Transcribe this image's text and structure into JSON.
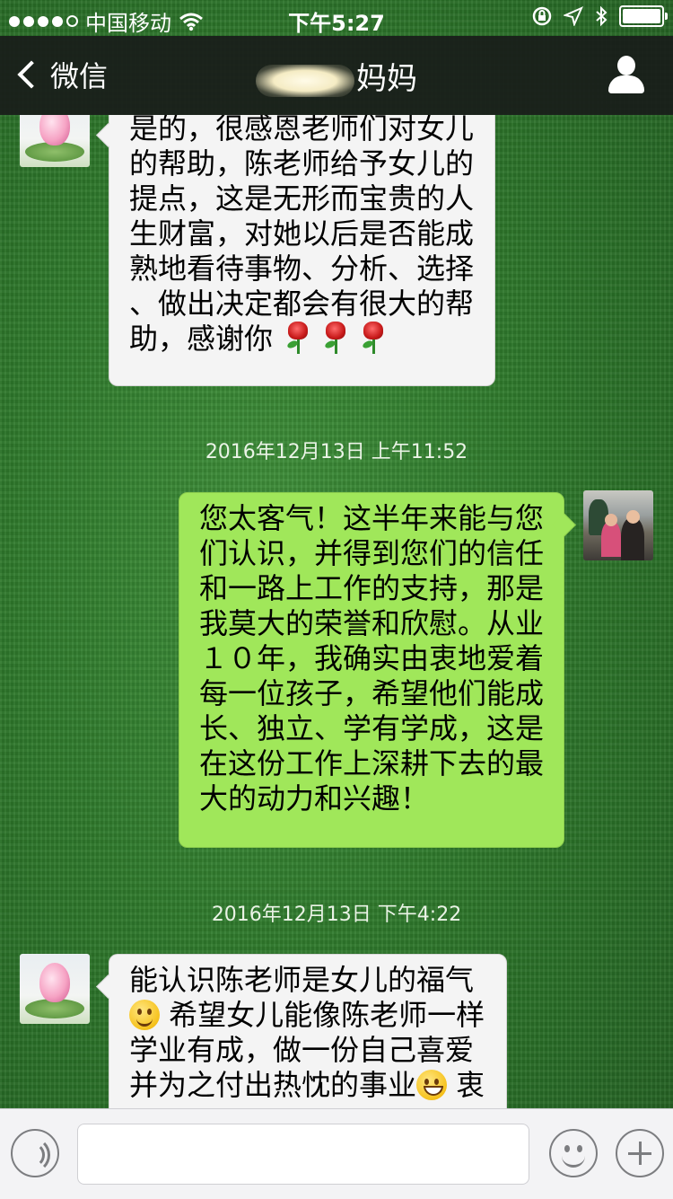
{
  "status_bar": {
    "carrier": "中国移动",
    "time": "下午5:27",
    "battery_level": 1.0
  },
  "nav": {
    "back_label": "微信",
    "title_suffix": "妈妈"
  },
  "messages": [
    {
      "side": "left",
      "avatar": "lotus-avatar",
      "lines": [
        "是的，很感恩老师们对女儿",
        "的帮助，陈老师给予女儿的",
        "提点，这是无形而宝贵的人",
        "生财富，对她以后是否能成",
        "熟地看待事物、分析、选择",
        "、做出决定都会有很大的帮",
        "助，感谢你"
      ],
      "trailing_icons": [
        "rose-emoji",
        "rose-emoji",
        "rose-emoji"
      ]
    },
    {
      "timestamp": "2016年12月13日 上午11:52"
    },
    {
      "side": "right",
      "avatar": "family-photo-avatar",
      "lines": [
        "您太客气！这半年来能与您",
        "们认识，并得到您们的信任",
        "和一路上工作的支持，那是",
        "我莫大的荣誉和欣慰。从业",
        "１０年，我确实由衷地爱着",
        "每一位孩子，希望他们能成",
        "长、独立、学有学成，这是",
        "在这份工作上深耕下去的最",
        "大的动力和兴趣！"
      ]
    },
    {
      "timestamp": "2016年12月13日 下午4:22"
    },
    {
      "side": "left",
      "avatar": "lotus-avatar",
      "line1": "能认识陈老师是女儿的福气",
      "line2_after_emoji": " 希望女儿能像陈老师一样",
      "line3": "学业有成，做一份自己喜爱",
      "line4_before_emoji": "并为之付出热忱的事业",
      "line4_after_emoji": " 衷"
    }
  ],
  "input_bar": {
    "icons": [
      "voice-icon",
      "emoji-icon",
      "add-icon"
    ]
  },
  "colors": {
    "outgoing_bubble": "#a0e75a",
    "incoming_bubble": "#f4f4f4",
    "nav_bg": "#1a1c1a"
  }
}
